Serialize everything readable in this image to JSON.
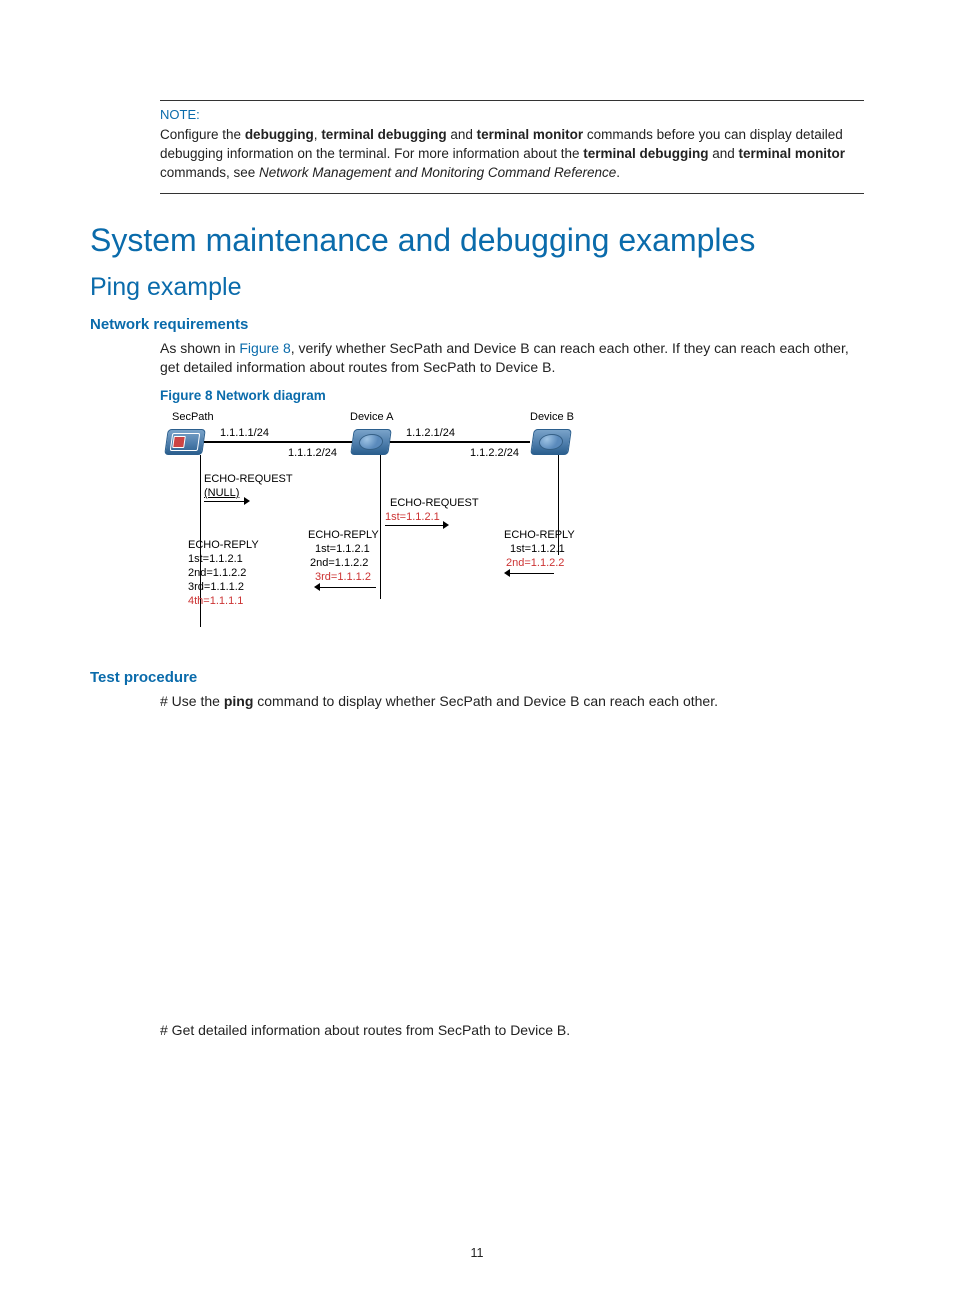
{
  "note": {
    "label": "NOTE:",
    "text_parts": {
      "a": "Configure the ",
      "b1": "debugging",
      "c": ", ",
      "b2": "terminal debugging",
      "d": " and ",
      "b3": "terminal monitor",
      "e": " commands before you can display detailed debugging information on the terminal. For more information about the ",
      "b4": "terminal debugging",
      "f": " and ",
      "b5": "terminal monitor",
      "g": " commands, see ",
      "i1": "Network Management and Monitoring Command Reference",
      "h": "."
    }
  },
  "headings": {
    "h1": "System maintenance and debugging examples",
    "h2": "Ping example",
    "h3a": "Network requirements",
    "h3b": "Test procedure",
    "fig_caption": "Figure 8 Network diagram"
  },
  "paragraphs": {
    "netreq_a": "As shown in ",
    "netreq_link": "Figure 8",
    "netreq_b": ", verify whether SecPath and Device B can reach each other. If they can reach each other, get detailed information about routes from SecPath to Device B.",
    "test1_a": "# Use the ",
    "test1_b": "ping",
    "test1_c": " command to display whether SecPath and Device B can reach each other.",
    "test2": "# Get detailed information about routes from SecPath to Device B."
  },
  "diagram": {
    "secpath": "SecPath",
    "devA": "Device A",
    "devB": "Device B",
    "ip1": "1.1.1.1/24",
    "ip2": "1.1.1.2/24",
    "ip3": "1.1.2.1/24",
    "ip4": "1.1.2.2/24",
    "echoReq": "ECHO-REQUEST",
    "null": "(NULL)",
    "echoReply": "ECHO-REPLY",
    "first121": "1st=1.1.2.1",
    "first121r": "1st=1.1.2.1",
    "second122": "2nd=1.1.2.2",
    "second122r": "2nd=1.1.2.2",
    "third112": "3rd=1.1.1.2",
    "third112r": "3rd=1.1.1.2",
    "fourth111": "4th=1.1.1.1"
  },
  "pageNumber": "11"
}
